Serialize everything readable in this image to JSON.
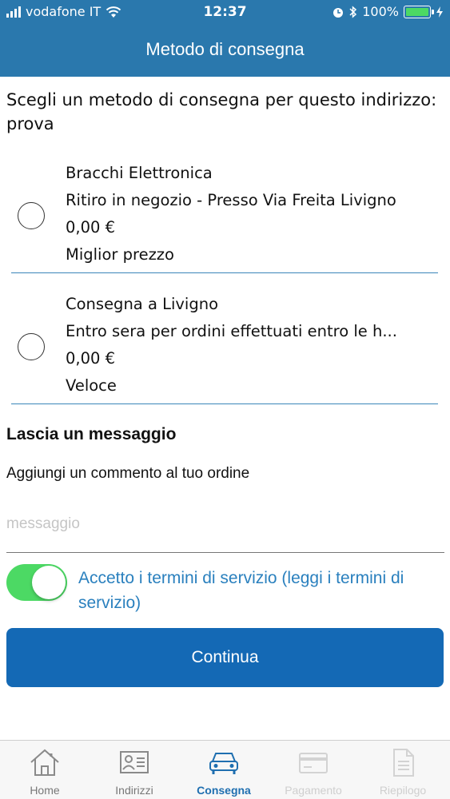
{
  "status_bar": {
    "carrier": "vodafone IT",
    "time": "12:37",
    "battery": "100%",
    "battery_level": 1.0
  },
  "header": {
    "title": "Metodo di consegna"
  },
  "intro": {
    "text": "Scegli un metodo di consegna per questo indirizzo: prova"
  },
  "options": [
    {
      "name": "Bracchi Elettronica",
      "description": "Ritiro in negozio - Presso Via Freita Livigno",
      "price": "0,00 €",
      "tag": "Miglior prezzo",
      "selected": false
    },
    {
      "name": "Consegna a Livigno",
      "description": "Entro sera per ordini effettuati entro le h...",
      "price": "0,00 €",
      "tag": "Veloce",
      "selected": false
    }
  ],
  "message": {
    "title": "Lascia un messaggio",
    "subtitle": "Aggiungi un commento al tuo ordine",
    "placeholder": "messaggio",
    "value": ""
  },
  "terms": {
    "text": "Accetto i termini di servizio (leggi i termini di servizio)",
    "accepted": true
  },
  "continue_button": {
    "label": "Continua"
  },
  "tabbar": {
    "tabs": [
      {
        "label": "Home",
        "icon": "home-icon",
        "state": "normal"
      },
      {
        "label": "Indirizzi",
        "icon": "address-card-icon",
        "state": "normal"
      },
      {
        "label": "Consegna",
        "icon": "car-icon",
        "state": "active"
      },
      {
        "label": "Pagamento",
        "icon": "credit-card-icon",
        "state": "disabled"
      },
      {
        "label": "Riepilogo",
        "icon": "document-icon",
        "state": "disabled"
      }
    ]
  },
  "colors": {
    "header": "#2a78ad",
    "accent": "#1469b5",
    "toggle_on": "#4cd964",
    "link": "#2a80be",
    "divider": "#3a86b9"
  }
}
